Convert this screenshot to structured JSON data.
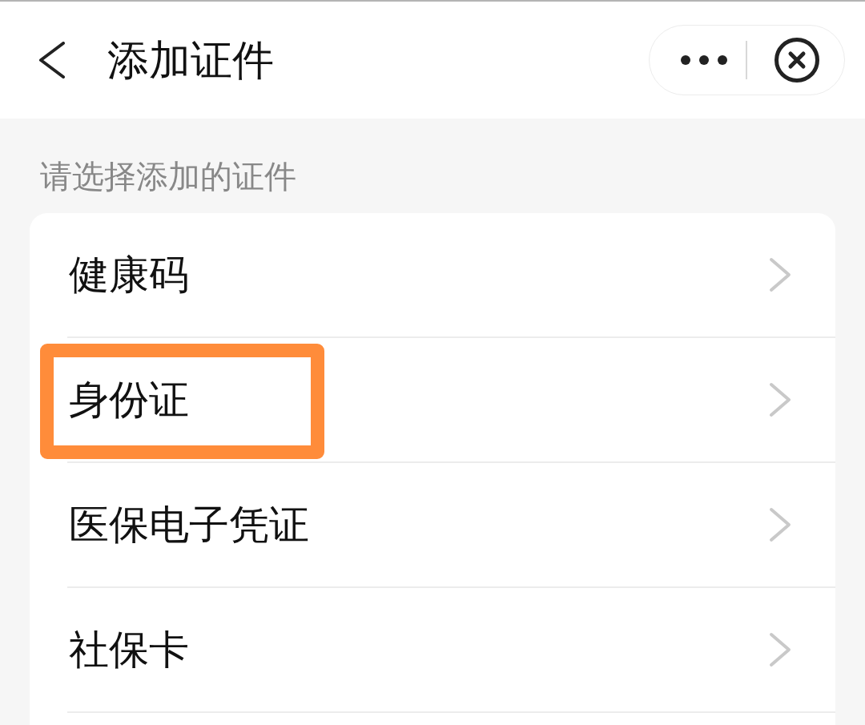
{
  "header": {
    "title": "添加证件"
  },
  "section": {
    "label": "请选择添加的证件"
  },
  "items": [
    {
      "label": "健康码",
      "highlighted": false
    },
    {
      "label": "身份证",
      "highlighted": true
    },
    {
      "label": "医保电子凭证",
      "highlighted": false
    },
    {
      "label": "社保卡",
      "highlighted": false
    }
  ]
}
